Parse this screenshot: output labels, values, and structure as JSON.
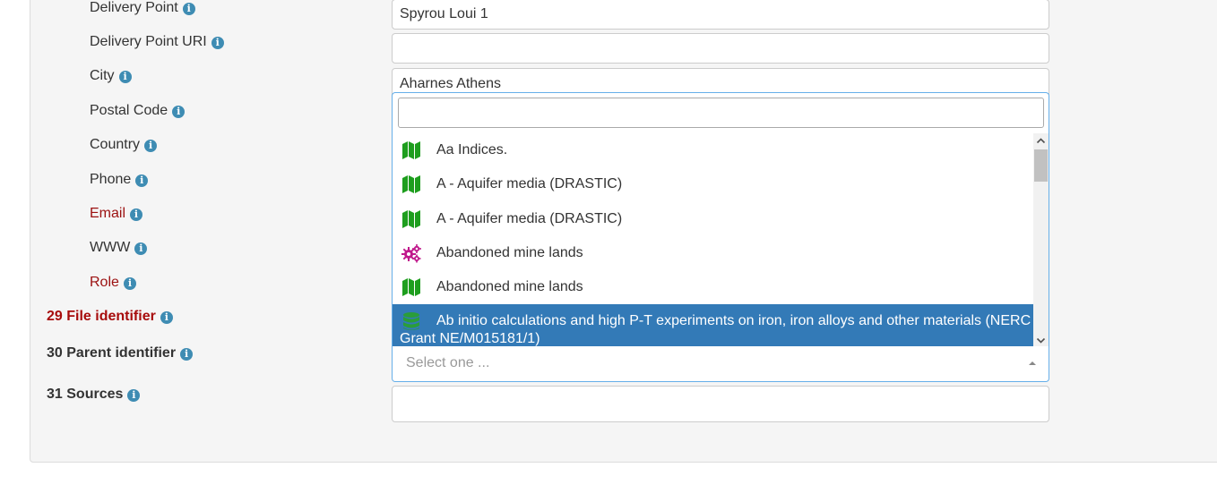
{
  "labels": {
    "delivery_point": "Delivery Point",
    "delivery_point_uri": "Delivery Point URI",
    "city": "City",
    "postal_code": "Postal Code",
    "country": "Country",
    "phone": "Phone",
    "email": "Email",
    "www": "WWW",
    "role": "Role",
    "file_identifier": "29 File identifier",
    "parent_identifier": "30 Parent identifier",
    "sources": "31 Sources"
  },
  "info_glyph": "i",
  "fields": {
    "delivery_point_value": "Spyrou Loui 1",
    "delivery_point_uri_value": "",
    "city_value": "Aharnes Athens",
    "sources_value": ""
  },
  "parent_select": {
    "placeholder": "Select one ...",
    "search_value": "",
    "options": [
      {
        "label": "Aa Indices.",
        "icon": "map-icon"
      },
      {
        "label": "A - Aquifer media (DRASTIC)",
        "icon": "map-icon"
      },
      {
        "label": "A - Aquifer media (DRASTIC)",
        "icon": "map-icon"
      },
      {
        "label": "Abandoned mine lands",
        "icon": "gears-icon"
      },
      {
        "label": "Abandoned mine lands",
        "icon": "map-icon"
      },
      {
        "label": "Ab initio calculations and high P-T experiments on iron, iron alloys and other materials (NERC Grant NE/M015181/1)",
        "icon": "database-icon",
        "highlighted": true
      }
    ]
  },
  "colors": {
    "required_label": "#9b1010",
    "info_icon": "#3e8cb3",
    "highlight": "#337ab7",
    "map_icon": "#1e9e1e",
    "gears_icon": "#c0198c",
    "database_icon": "#2a9d3a"
  }
}
